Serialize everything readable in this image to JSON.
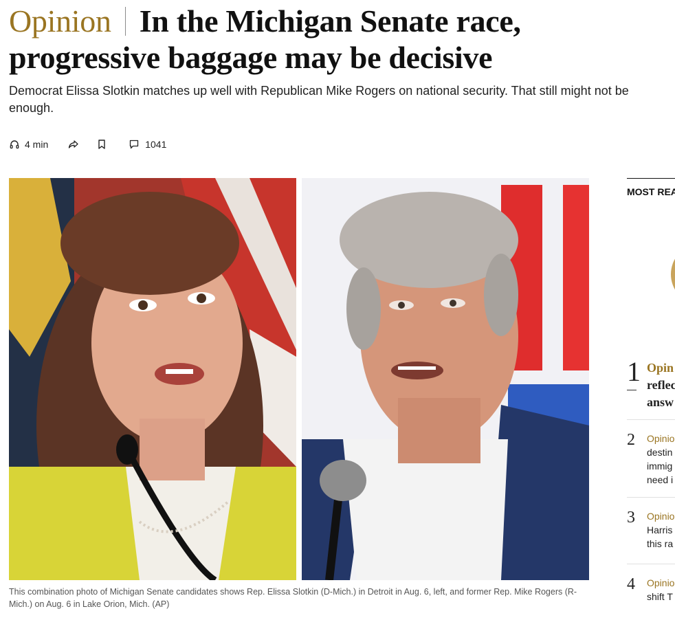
{
  "article": {
    "kicker": "Opinion",
    "headline_line1": "In the Michigan Senate race,",
    "headline_line2": "progressive baggage may be decisive",
    "dek": "Democrat Elissa Slotkin matches up well with Republican Mike Rogers on national security. That still might not be enough.",
    "listen_time": "4 min",
    "comments_count": "1041",
    "caption": "This combination photo of Michigan Senate candidates shows Rep. Elissa Slotkin (D-Mich.) in Detroit in Aug. 6, left, and former Rep. Mike Rogers (R-Mich.) on Aug. 6 in Lake Orion, Mich. (AP)"
  },
  "icons": {
    "listen": "headphones-icon",
    "share": "share-arrow-icon",
    "save": "bookmark-icon",
    "comments": "comment-bubble-icon"
  },
  "sidebar": {
    "title": "MOST REA",
    "items": [
      {
        "rank": "1",
        "kicker": "Opin",
        "lines": [
          "reflec",
          "answ"
        ]
      },
      {
        "rank": "2",
        "kicker": "Opinio",
        "lines": [
          "destin",
          "immig",
          "need i"
        ]
      },
      {
        "rank": "3",
        "kicker": "Opinio",
        "lines": [
          "Harris",
          "this ra"
        ]
      },
      {
        "rank": "4",
        "kicker": "Opinio",
        "lines": [
          "shift T"
        ]
      }
    ]
  },
  "colors": {
    "kicker": "#9a7522",
    "text": "#111111",
    "caption": "#555555",
    "divider": "#8a8a8a"
  }
}
